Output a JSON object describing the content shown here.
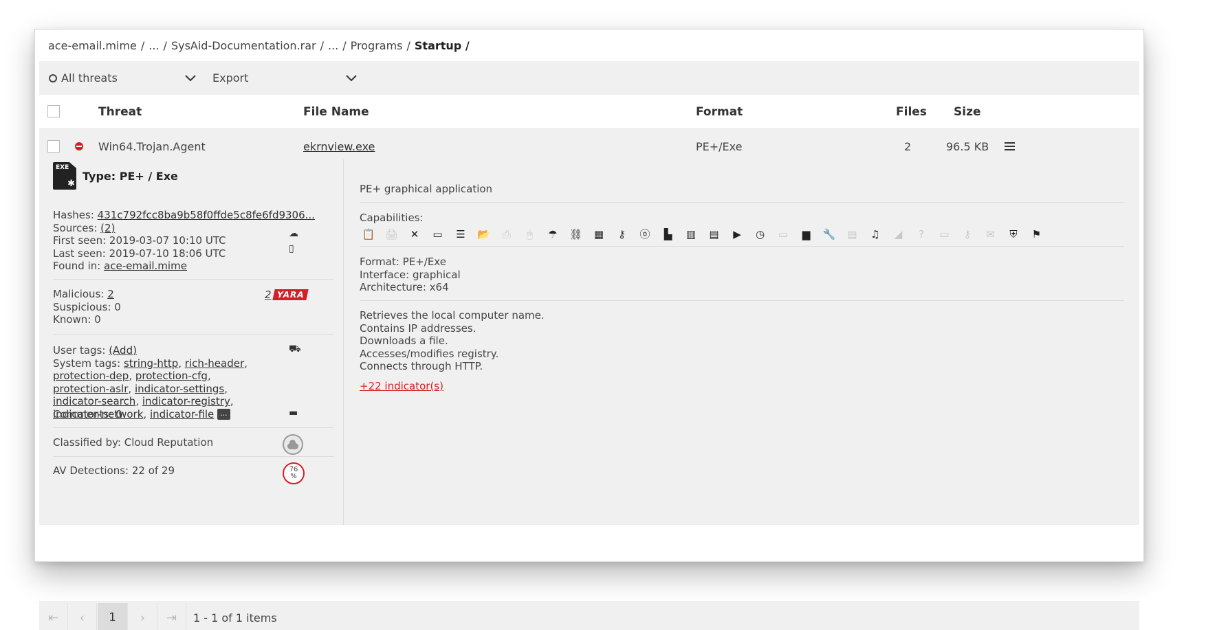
{
  "breadcrumb": {
    "items": [
      "ace-email.mime",
      "...",
      "SysAid-Documentation.rar",
      "...",
      "Programs"
    ],
    "current": "Startup /"
  },
  "toolbar": {
    "filter_label": "All threats",
    "export_label": "Export"
  },
  "table": {
    "headers": {
      "threat": "Threat",
      "file_name": "File Name",
      "format": "Format",
      "files": "Files",
      "size": "Size"
    },
    "row": {
      "threat": "Win64.Trojan.Agent",
      "file_name": "ekrnview.exe",
      "format": "PE+/Exe",
      "files": "2",
      "size": "96.5 KB"
    }
  },
  "details": {
    "exe_label": "EXE",
    "type": "Type: PE+ / Exe",
    "hashes_label": "Hashes:",
    "hashes_value": "431c792fcc8ba9b58f0ffde5c8fe6fd9306...",
    "sources_label": "Sources:",
    "sources_value": "(2)",
    "first_seen": "First seen: 2019-03-07 10:10 UTC",
    "last_seen": "Last seen: 2019-07-10 18:06 UTC",
    "found_in_label": "Found in:",
    "found_in_value": "ace-email.mime",
    "malicious_label": "Malicious:",
    "malicious_value": "2",
    "suspicious": "Suspicious: 0",
    "known": "Known: 0",
    "yara_count": "2",
    "yara_badge": "YARA",
    "user_tags_label": "User tags:",
    "user_tags_add": "(Add)",
    "system_tags_label": "System tags:",
    "system_tags": [
      "string-http",
      "rich-header",
      "protection-dep",
      "protection-cfg",
      "protection-aslr",
      "indicator-settings",
      "indicator-search",
      "indicator-registry",
      "indicator-network",
      "indicator-file"
    ],
    "more_label": "...",
    "comments_label": "Comments:",
    "comments_value": "0",
    "classified_by": "Classified by: Cloud Reputation",
    "av_detections": "AV Detections: 22 of 29",
    "av_percent": "76",
    "av_percent_sign": "%"
  },
  "right": {
    "description": "PE+ graphical application",
    "capabilities_label": "Capabilities:",
    "capabilities": [
      {
        "name": "clipboard-icon",
        "glyph": "📋",
        "active": false
      },
      {
        "name": "printer-icon",
        "glyph": "🖨",
        "active": false
      },
      {
        "name": "crosshair-icon",
        "glyph": "✕",
        "active": true
      },
      {
        "name": "window-icon",
        "glyph": "▭",
        "active": true
      },
      {
        "name": "list-icon",
        "glyph": "☰",
        "active": true
      },
      {
        "name": "folder-icon",
        "glyph": "📂",
        "active": true
      },
      {
        "name": "print-icon",
        "glyph": "⎙",
        "active": false
      },
      {
        "name": "mouse-icon",
        "glyph": "🖱",
        "active": false
      },
      {
        "name": "network-icon",
        "glyph": "☂",
        "active": true
      },
      {
        "name": "tree-icon",
        "glyph": "⛓",
        "active": true
      },
      {
        "name": "memory-icon",
        "glyph": "▦",
        "active": true
      },
      {
        "name": "key-icon",
        "glyph": "⚷",
        "active": true
      },
      {
        "name": "os-icon",
        "glyph": "ⓞ",
        "active": true
      },
      {
        "name": "plugin-icon",
        "glyph": "▙",
        "active": true
      },
      {
        "name": "chip-icon",
        "glyph": "▥",
        "active": true
      },
      {
        "name": "browser-icon",
        "glyph": "▤",
        "active": true
      },
      {
        "name": "terminal-icon",
        "glyph": "▶",
        "active": true
      },
      {
        "name": "clock-icon",
        "glyph": "◷",
        "active": true
      },
      {
        "name": "id-card-icon",
        "glyph": "▭",
        "active": false
      },
      {
        "name": "monitor-icon",
        "glyph": "▆",
        "active": true
      },
      {
        "name": "wrench-icon",
        "glyph": "🔧",
        "active": true
      },
      {
        "name": "document-icon",
        "glyph": "▤",
        "active": false
      },
      {
        "name": "music-icon",
        "glyph": "♫",
        "active": true
      },
      {
        "name": "camera-icon",
        "glyph": "◢",
        "active": false
      },
      {
        "name": "help-icon",
        "glyph": "?",
        "active": false
      },
      {
        "name": "screen-icon",
        "glyph": "▭",
        "active": false
      },
      {
        "name": "key2-icon",
        "glyph": "⚷",
        "active": false
      },
      {
        "name": "mail-icon",
        "glyph": "✉",
        "active": false
      },
      {
        "name": "shield-icon",
        "glyph": "⛨",
        "active": true
      },
      {
        "name": "flag-icon",
        "glyph": "⚑",
        "active": true
      }
    ],
    "format": "Format: PE+/Exe",
    "interface": "Interface: graphical",
    "architecture": "Architecture: x64",
    "indicators": [
      "Retrieves the local computer name.",
      "Contains IP addresses.",
      "Downloads a file.",
      "Accesses/modifies registry.",
      "Connects through HTTP."
    ],
    "more_indicators": "+22 indicator(s)"
  },
  "pager": {
    "page": "1",
    "info": "1 - 1 of 1 items"
  },
  "colors": {
    "accent": "#d31f26",
    "panel": "#f0f0f0"
  }
}
